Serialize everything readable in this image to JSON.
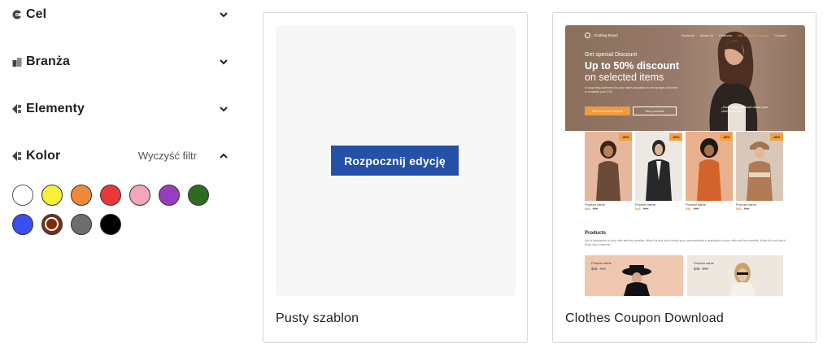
{
  "filters": [
    {
      "id": "cel",
      "label": "Cel",
      "icon": "target-icon",
      "expanded": false
    },
    {
      "id": "branza",
      "label": "Branża",
      "icon": "building-icon",
      "expanded": false
    },
    {
      "id": "elementy",
      "label": "Elementy",
      "icon": "elements-icon",
      "expanded": false
    },
    {
      "id": "kolor",
      "label": "Kolor",
      "icon": "palette-icon",
      "expanded": true,
      "clear_label": "Wyczyść filtr"
    }
  ],
  "colors": [
    {
      "name": "white",
      "hex": "#ffffff",
      "selected": false
    },
    {
      "name": "yellow",
      "hex": "#f6f03a",
      "selected": false
    },
    {
      "name": "orange",
      "hex": "#f0883a",
      "selected": false
    },
    {
      "name": "red",
      "hex": "#e8383a",
      "selected": false
    },
    {
      "name": "pink",
      "hex": "#f2a6b8",
      "selected": false
    },
    {
      "name": "purple",
      "hex": "#9a3cbf",
      "selected": false
    },
    {
      "name": "green",
      "hex": "#2e6b22",
      "selected": false
    },
    {
      "name": "blue",
      "hex": "#3a4ef2",
      "selected": false
    },
    {
      "name": "brown",
      "hex": "#7a2e12",
      "selected": true
    },
    {
      "name": "gray",
      "hex": "#6e6e6e",
      "selected": false
    },
    {
      "name": "black",
      "hex": "#000000",
      "selected": false
    }
  ],
  "cards": {
    "blank": {
      "caption": "Pusty szablon",
      "button_label": "Rozpocznij edycję"
    },
    "template": {
      "caption": "Clothes Coupon Download",
      "preview": {
        "brand": "Clothing Brand",
        "nav": [
          "Products",
          "About Us",
          "Features",
          "Get Discount Coupon",
          "Contact"
        ],
        "eyebrow": "Get special Discount",
        "headline": "Up to 50% discount",
        "headline2": "on selected items",
        "subtext": "A supporting statement for your value proposition to encourage customers to complete your CTA",
        "cta_primary": "Get Discount Coupon",
        "cta_secondary": "See products",
        "quote": "„Something profound about your clothing brand\"",
        "badge": "-40%",
        "product_name": "Product name",
        "price": "$46",
        "old_price": "$58",
        "section_title": "Products",
        "section_desc": "Add a description of your offer and key benefits. What it is and how it helps your customersAdd a description of your offer and key benefits. What it is and how it helps your customer."
      }
    }
  }
}
